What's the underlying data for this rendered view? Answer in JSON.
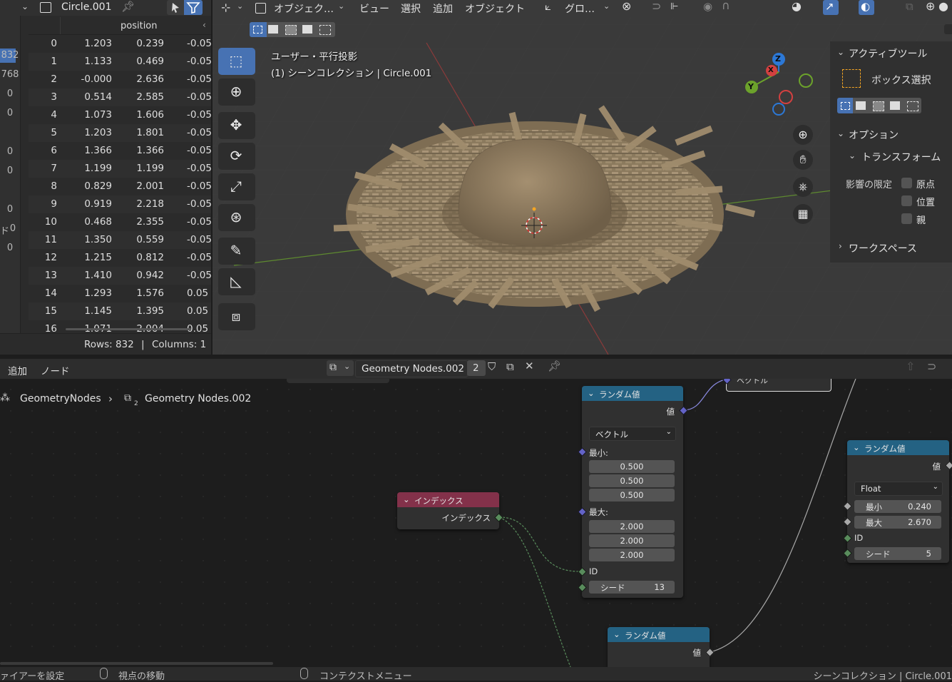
{
  "spreadsheet": {
    "object_name": "Circle.001",
    "column_header": "position",
    "left_counts": [
      "832",
      "768",
      "0",
      "0",
      "",
      "0",
      "0",
      "",
      "0",
      "0",
      "0"
    ],
    "left_count_prefix": "ド",
    "rows": [
      {
        "i": "0",
        "a": "1.203",
        "b": "0.239",
        "c": "-0.05"
      },
      {
        "i": "1",
        "a": "1.133",
        "b": "0.469",
        "c": "-0.05"
      },
      {
        "i": "2",
        "a": "-0.000",
        "b": "2.636",
        "c": "-0.05"
      },
      {
        "i": "3",
        "a": "0.514",
        "b": "2.585",
        "c": "-0.05"
      },
      {
        "i": "4",
        "a": "1.073",
        "b": "1.606",
        "c": "-0.05"
      },
      {
        "i": "5",
        "a": "1.203",
        "b": "1.801",
        "c": "-0.05"
      },
      {
        "i": "6",
        "a": "1.366",
        "b": "1.366",
        "c": "-0.05"
      },
      {
        "i": "7",
        "a": "1.199",
        "b": "1.199",
        "c": "-0.05"
      },
      {
        "i": "8",
        "a": "0.829",
        "b": "2.001",
        "c": "-0.05"
      },
      {
        "i": "9",
        "a": "0.919",
        "b": "2.218",
        "c": "-0.05"
      },
      {
        "i": "10",
        "a": "0.468",
        "b": "2.355",
        "c": "-0.05"
      },
      {
        "i": "11",
        "a": "1.350",
        "b": "0.559",
        "c": "-0.05"
      },
      {
        "i": "12",
        "a": "1.215",
        "b": "0.812",
        "c": "-0.05"
      },
      {
        "i": "13",
        "a": "1.410",
        "b": "0.942",
        "c": "-0.05"
      },
      {
        "i": "14",
        "a": "1.293",
        "b": "1.576",
        "c": "0.05"
      },
      {
        "i": "15",
        "a": "1.145",
        "b": "1.395",
        "c": "0.05"
      },
      {
        "i": "16",
        "a": "1.071",
        "b": "2.004",
        "c": "0.05"
      }
    ],
    "rows_label": "Rows: 832",
    "columns_label": "Columns: 1",
    "separator": "|"
  },
  "viewport": {
    "mode": "オブジェク…",
    "menus": [
      "ビュー",
      "選択",
      "追加",
      "オブジェクト"
    ],
    "transform_orientation": "グロ…",
    "view_label": "ユーザー・平行投影",
    "collection_label": "(1) シーンコレクション | Circle.001",
    "axes": {
      "x": "X",
      "y": "Y",
      "z": "Z"
    },
    "npanel": {
      "active_tool_title": "アクティブツール",
      "active_tool_name": "ボックス選択",
      "options_title": "オプション",
      "transform_title": "トランスフォーム",
      "affect_only": "影響の限定",
      "origins": "原点",
      "locations": "位置",
      "parents": "親",
      "workspace_title": "ワークスペース"
    }
  },
  "node_editor": {
    "menus": [
      "追加",
      "ノード"
    ],
    "tree_name": "Geometry Nodes.002",
    "user_count": "2",
    "breadcrumb_root": "GeometryNodes",
    "breadcrumb_leaf": "Geometry Nodes.002",
    "breadcrumb_leaf_sub": "2",
    "index_node": {
      "title": "インデックス",
      "output": "インデックス"
    },
    "random_vector": {
      "title": "ランダム値",
      "output": "値",
      "type": "ベクトル",
      "min_label": "最小:",
      "min": [
        "0.500",
        "0.500",
        "0.500"
      ],
      "max_label": "最大:",
      "max": [
        "2.000",
        "2.000",
        "2.000"
      ],
      "id_label": "ID",
      "seed_label": "シード",
      "seed": "13"
    },
    "random_float": {
      "title": "ランダム値",
      "output": "値",
      "type": "Float",
      "min_label": "最小",
      "min": "0.240",
      "max_label": "最大",
      "max": "2.670",
      "id_label": "ID",
      "seed_label": "シード",
      "seed": "5"
    },
    "random_bottom": {
      "title": "ランダム値",
      "output": "値"
    },
    "top_node_label": "ベクトル"
  },
  "statusbar": {
    "left": "ァイアーを設定",
    "middle": "視点の移動",
    "right_menu": "コンテクストメニュー",
    "scene_info": "シーンコレクション | Circle.001"
  },
  "colors": {
    "accent_blue": "#4772b3",
    "node_header_input": "#83314a",
    "node_header_util": "#246283",
    "socket_vector": "#6363c7",
    "socket_int": "#598c5c"
  }
}
